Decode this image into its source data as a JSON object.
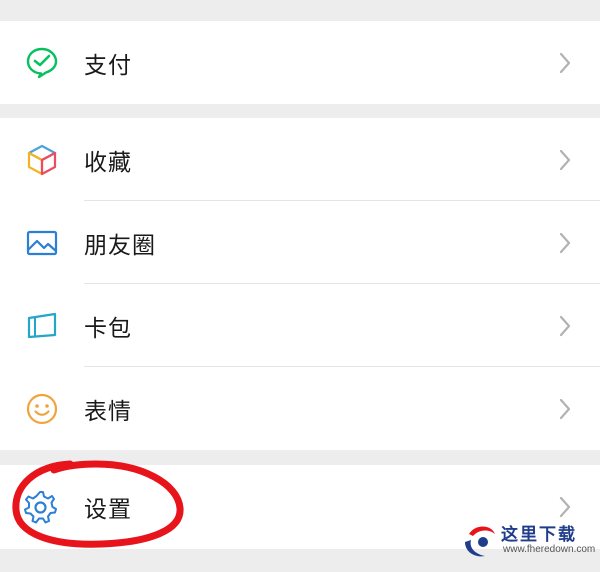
{
  "menu": {
    "pay": {
      "label": "支付",
      "icon": "wechat-pay-icon"
    },
    "favorites": {
      "label": "收藏",
      "icon": "cube-icon"
    },
    "moments": {
      "label": "朋友圈",
      "icon": "picture-icon"
    },
    "cards": {
      "label": "卡包",
      "icon": "card-icon"
    },
    "stickers": {
      "label": "表情",
      "icon": "smiley-icon"
    },
    "settings": {
      "label": "设置",
      "icon": "gear-icon"
    }
  },
  "watermark": {
    "text": "这里下载",
    "url": "www.fheredown.com"
  },
  "colors": {
    "background": "#ededed",
    "row": "#ffffff",
    "annotation": "#e8141c",
    "pay_green": "#07c160",
    "gear_blue": "#2b7fd4"
  }
}
